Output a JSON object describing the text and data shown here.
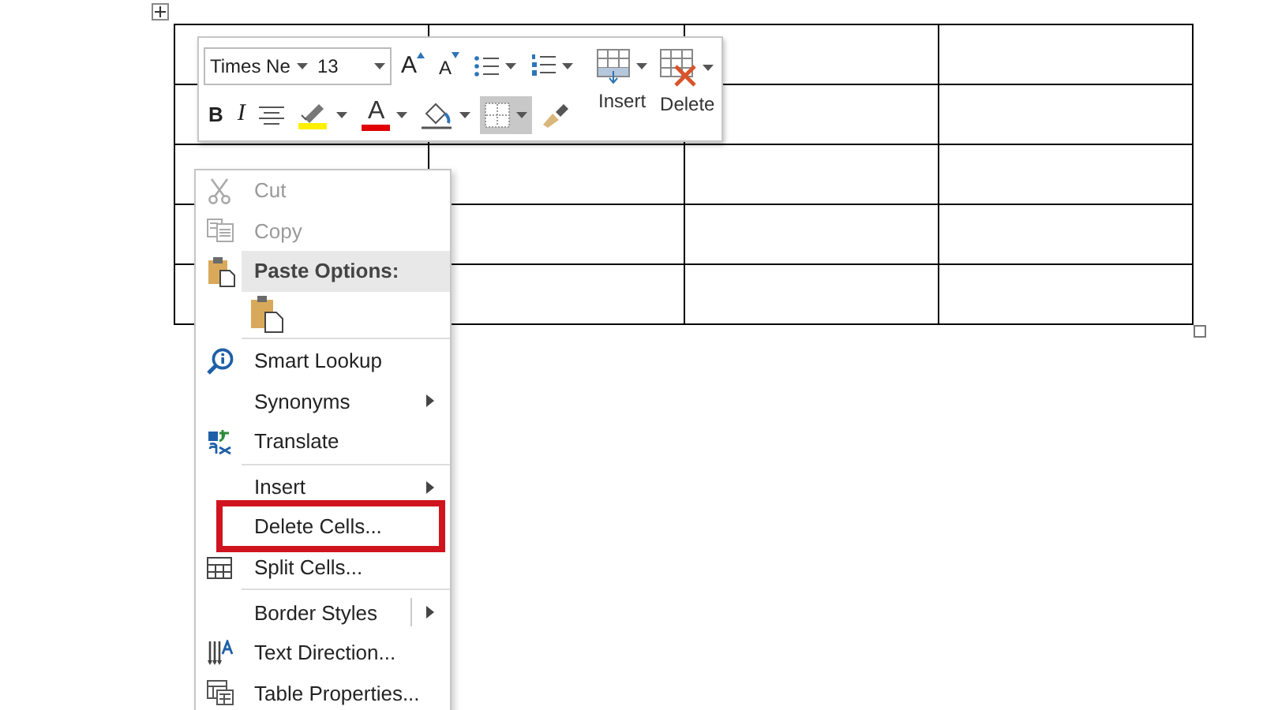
{
  "mini_toolbar": {
    "row_1": [
      {
        "kind": "combo",
        "value": "Times Ne"
      },
      {
        "kind": "combo",
        "value": "13"
      },
      {
        "kind": "grow",
        "glyph": "A",
        "pressed": false
      },
      {
        "kind": "shrink",
        "glyph": "A",
        "pressed": false
      },
      {
        "kind": "bullets",
        "pressed": false
      },
      {
        "kind": "numbering",
        "pressed": false
      }
    ],
    "row_2": [
      {
        "kind": "bold",
        "glyph": "B",
        "pressed": false
      },
      {
        "kind": "italic",
        "glyph": "I",
        "pressed": false
      },
      {
        "kind": "center",
        "pressed": false
      },
      {
        "kind": "highlight",
        "pressed": false
      },
      {
        "kind": "font_color",
        "glyph": "A",
        "pressed": false
      },
      {
        "kind": "shading",
        "pressed": false
      },
      {
        "kind": "borders",
        "pressed": true
      },
      {
        "kind": "painter",
        "pressed": false
      }
    ],
    "big_buttons": [
      {
        "kind": "insert",
        "label": "Insert"
      },
      {
        "kind": "delete",
        "label": "Delete"
      }
    ]
  },
  "context_menu": [
    {
      "kind": "item",
      "label": "Cut",
      "disabled": true,
      "submenu": false,
      "split": false,
      "marked": false
    },
    {
      "kind": "item",
      "label": "Copy",
      "disabled": true,
      "submenu": false,
      "split": false,
      "marked": false
    },
    {
      "kind": "header",
      "label": "Paste Options:"
    },
    {
      "kind": "paste_choices"
    },
    {
      "kind": "separator"
    },
    {
      "kind": "item",
      "label": "Smart Lookup",
      "disabled": false,
      "submenu": false,
      "split": false,
      "marked": false
    },
    {
      "kind": "item",
      "label": "Synonyms",
      "disabled": false,
      "submenu": true,
      "split": false,
      "marked": false
    },
    {
      "kind": "item",
      "label": "Translate",
      "disabled": false,
      "submenu": false,
      "split": false,
      "marked": false
    },
    {
      "kind": "separator"
    },
    {
      "kind": "item",
      "label": "Insert",
      "disabled": false,
      "submenu": true,
      "split": false,
      "marked": false
    },
    {
      "kind": "item",
      "label": "Delete Cells...",
      "disabled": false,
      "submenu": false,
      "split": false,
      "marked": true
    },
    {
      "kind": "item",
      "label": "Split Cells...",
      "disabled": false,
      "submenu": false,
      "split": false,
      "marked": false
    },
    {
      "kind": "separator"
    },
    {
      "kind": "item",
      "label": "Border Styles",
      "disabled": false,
      "submenu": true,
      "split": true,
      "marked": false
    },
    {
      "kind": "item",
      "label": "Text Direction...",
      "disabled": false,
      "submenu": false,
      "split": false,
      "marked": false
    },
    {
      "kind": "item",
      "label": "Table Properties...",
      "disabled": false,
      "submenu": false,
      "split": false,
      "marked": false
    }
  ]
}
